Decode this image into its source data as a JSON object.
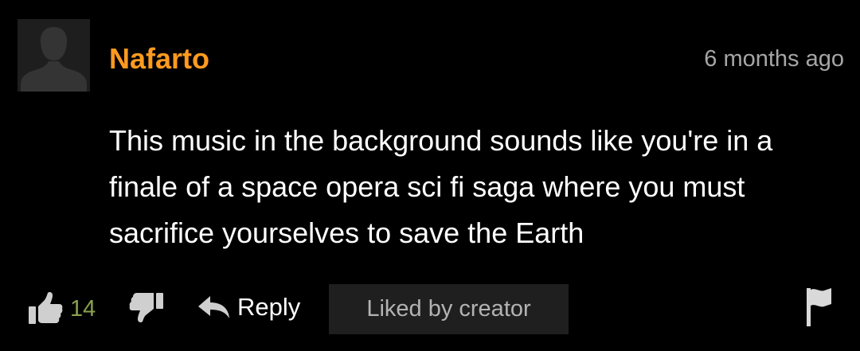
{
  "comment": {
    "username": "Nafarto",
    "timestamp": "6 months ago",
    "text_lines": [
      "This music in the background sounds like you're in a",
      "finale of a space opera sci fi saga where you must",
      "sacrifice yourselves to save the Earth"
    ],
    "avatar_icon": "default-user-silhouette",
    "colors": {
      "username": "#ff9a1f",
      "like_count": "#8aa04e",
      "background": "#000000"
    }
  },
  "actions": {
    "like_icon": "thumbs-up-icon",
    "like_count": "14",
    "dislike_icon": "thumbs-down-icon",
    "reply_icon": "reply-arrow-icon",
    "reply_label": "Reply",
    "liked_badge": "Liked by creator",
    "flag_icon": "flag-icon"
  }
}
